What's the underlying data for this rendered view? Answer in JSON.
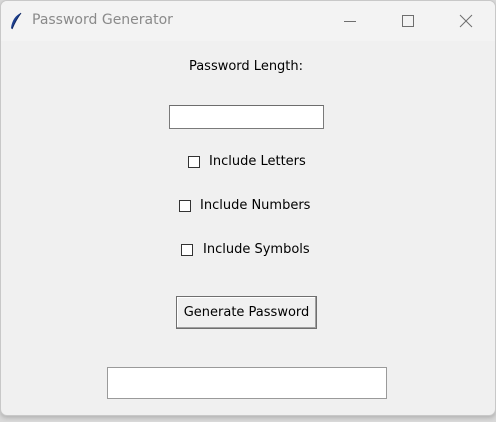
{
  "window": {
    "title": "Password Generator",
    "app_icon": "feather-icon",
    "controls": [
      "minimize-icon",
      "maximize-icon",
      "close-icon"
    ]
  },
  "form": {
    "length_label": "Password Length:",
    "length_value": "",
    "options": [
      {
        "label": "Include Letters",
        "checked": false
      },
      {
        "label": "Include Numbers",
        "checked": false
      },
      {
        "label": "Include Symbols",
        "checked": false
      }
    ],
    "generate_button_label": "Generate Password",
    "output_value": ""
  },
  "colors": {
    "window_bg": "#f0f0f0",
    "titlebar_bg": "#f3f3f3",
    "title_text": "#8a8a8a",
    "icon_blue": "#1d3f8f"
  }
}
